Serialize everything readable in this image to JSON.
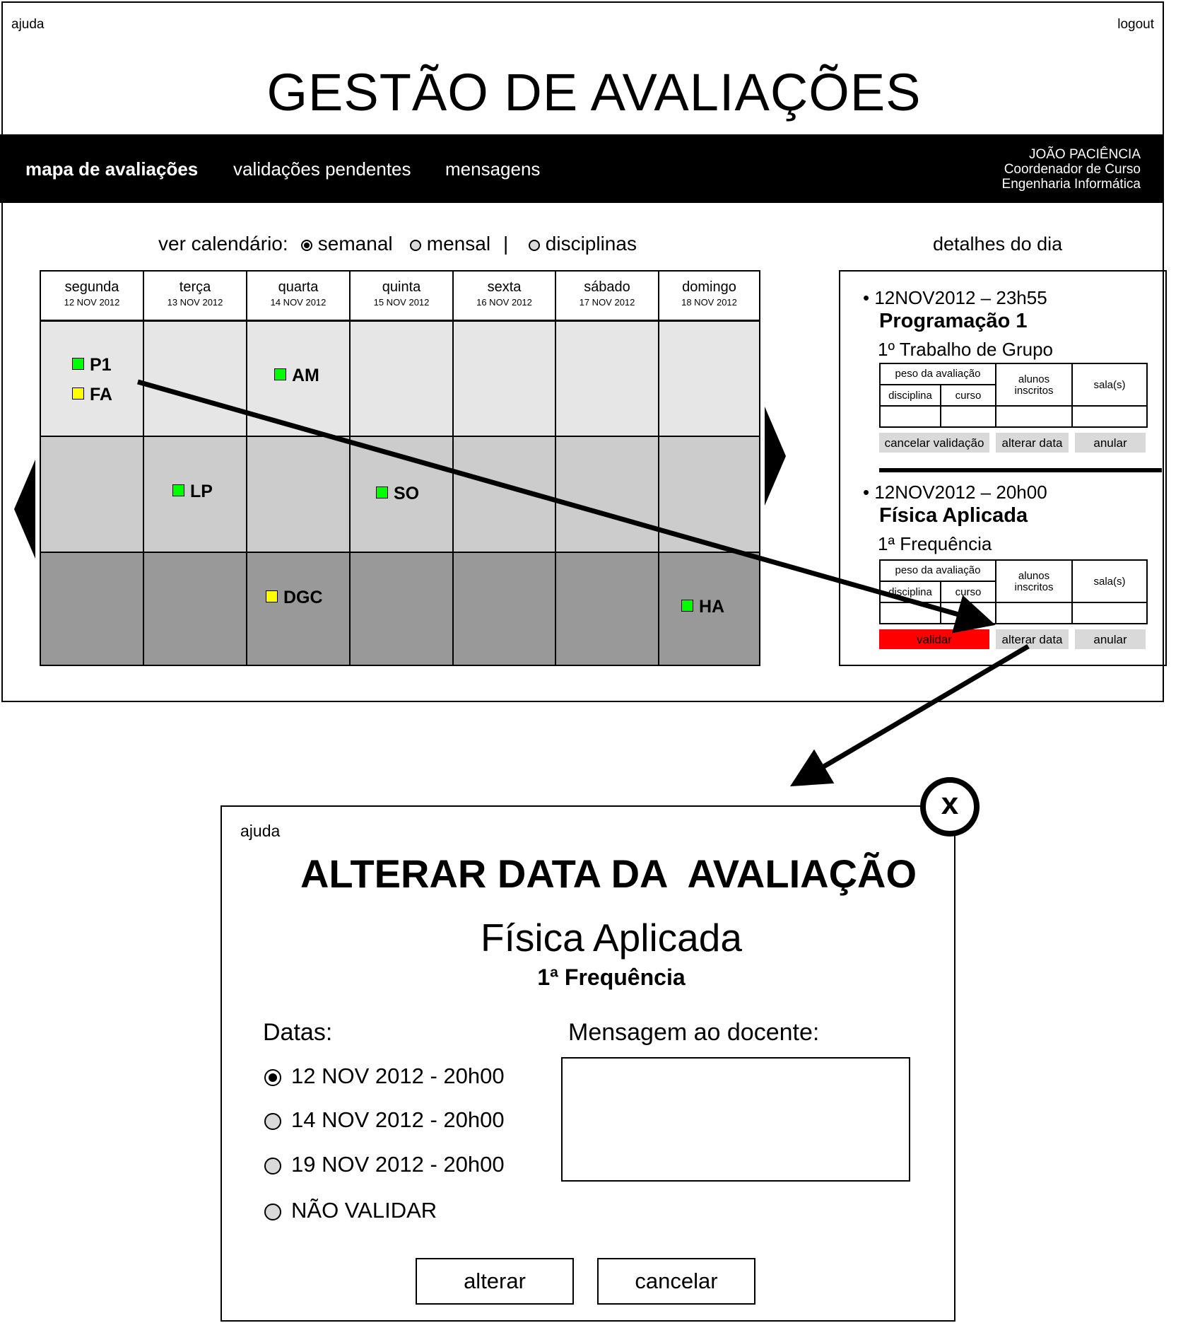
{
  "main": {
    "help_label": "ajuda",
    "logout_label": "logout",
    "title": "GESTÃO DE AVALIAÇÕES",
    "nav": [
      {
        "label": "mapa de avaliações",
        "active": true
      },
      {
        "label": "validações pendentes",
        "active": false
      },
      {
        "label": "mensagens",
        "active": false
      }
    ],
    "user": {
      "name": "JOÃO PACIÊNCIA",
      "role": "Coordenador de Curso",
      "course": "Engenharia Informática"
    }
  },
  "view_selector": {
    "label": "ver calendário:",
    "options": [
      {
        "label": "semanal",
        "checked": true
      },
      {
        "label": "mensal",
        "checked": false
      },
      {
        "label": "disciplinas",
        "checked": false
      }
    ],
    "separator": "|"
  },
  "calendar": {
    "days": [
      {
        "name": "segunda",
        "date": "12 NOV 2012"
      },
      {
        "name": "terça",
        "date": "13 NOV 2012"
      },
      {
        "name": "quarta",
        "date": "14 NOV 2012"
      },
      {
        "name": "quinta",
        "date": "15 NOV 2012"
      },
      {
        "name": "sexta",
        "date": "16 NOV 2012"
      },
      {
        "name": "sábado",
        "date": "17 NOV 2012"
      },
      {
        "name": "domingo",
        "date": "18 NOV 2012"
      }
    ],
    "row_colors": [
      "#e6e6e6",
      "#cccccc",
      "#999999"
    ],
    "evaluations": [
      {
        "label": "P1",
        "status_color": "#00ff00"
      },
      {
        "label": "FA",
        "status_color": "#ffff00"
      },
      {
        "label": "AM",
        "status_color": "#00ff00"
      },
      {
        "label": "LP",
        "status_color": "#00ff00"
      },
      {
        "label": "SO",
        "status_color": "#00ff00"
      },
      {
        "label": "DGC",
        "status_color": "#ffff00"
      },
      {
        "label": "HA",
        "status_color": "#00ff00"
      }
    ],
    "prev_icon": "triangle-left-icon",
    "next_icon": "triangle-right-icon"
  },
  "day_details": {
    "title": "detalhes do dia",
    "bullet": "•",
    "table_headers": {
      "weight": "peso da avaliação",
      "subject": "disciplina",
      "course": "curso",
      "students_line1": "alunos",
      "students_line2": "inscritos",
      "rooms": "sala(s)"
    },
    "entries": [
      {
        "datetime": "12NOV2012 – 23h55",
        "subject": "Programação 1",
        "type": "1º Trabalho de Grupo",
        "buttons": [
          "cancelar validação",
          "alterar data",
          "anular"
        ]
      },
      {
        "datetime": "12NOV2012 – 20h00",
        "subject": "Física Aplicada",
        "type": "1ª Frequência",
        "buttons": [
          "validar",
          "alterar data",
          "anular"
        ]
      }
    ]
  },
  "dialog": {
    "help_label": "ajuda",
    "close_label": "x",
    "title": "ALTERAR DATA DA  AVALIAÇÃO",
    "subject": "Física Aplicada",
    "eval_type": "1ª Frequência",
    "dates_label": "Datas:",
    "date_options": [
      {
        "label": "12 NOV 2012 - 20h00",
        "checked": true
      },
      {
        "label": "14 NOV 2012 - 20h00",
        "checked": false
      },
      {
        "label": "19 NOV 2012 - 20h00",
        "checked": false
      },
      {
        "label": "NÃO VALIDAR",
        "checked": false
      }
    ],
    "message_label": "Mensagem ao docente:",
    "message_value": "",
    "alter_label": "alterar",
    "cancel_label": "cancelar"
  }
}
